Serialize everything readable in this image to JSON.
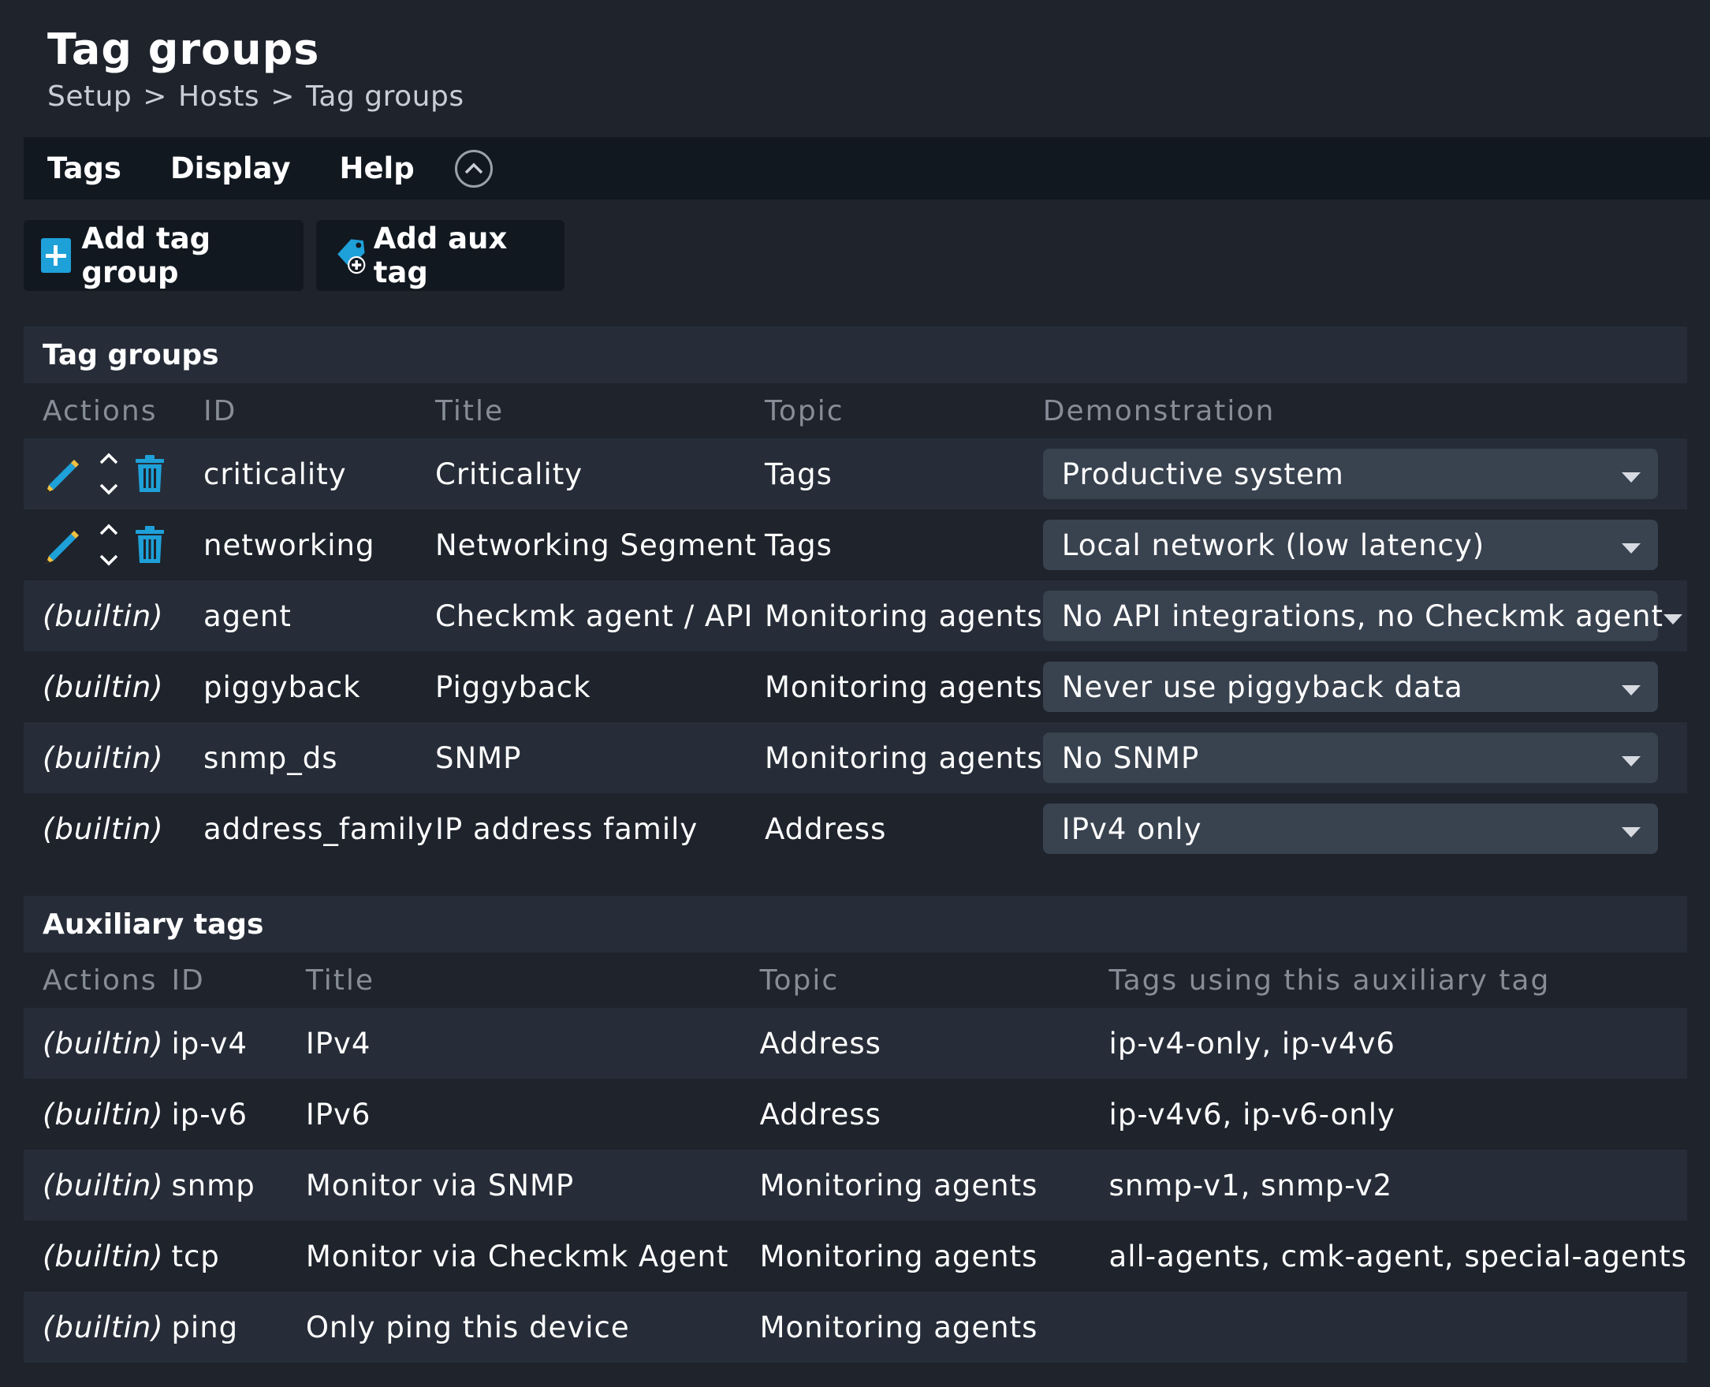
{
  "page": {
    "title": "Tag groups",
    "breadcrumb": [
      "Setup",
      "Hosts",
      "Tag groups"
    ],
    "breadcrumb_separator": ">"
  },
  "menu": {
    "items": [
      "Tags",
      "Display",
      "Help"
    ]
  },
  "buttons": {
    "add_tag_group": "Add tag group",
    "add_aux_tag": "Add aux tag"
  },
  "tag_groups": {
    "title": "Tag groups",
    "columns": [
      "Actions",
      "ID",
      "Title",
      "Topic",
      "Demonstration"
    ],
    "rows": [
      {
        "actions": "",
        "id": "criticality",
        "title": "Criticality",
        "topic": "Tags",
        "demo": "Productive system",
        "editable": true
      },
      {
        "actions": "",
        "id": "networking",
        "title": "Networking Segment",
        "topic": "Tags",
        "demo": "Local network (low latency)",
        "editable": true
      },
      {
        "actions": "(builtin)",
        "id": "agent",
        "title": "Checkmk agent / API",
        "topic": "Monitoring agents",
        "demo": "No API integrations, no Checkmk agent",
        "editable": false
      },
      {
        "actions": "(builtin)",
        "id": "piggyback",
        "title": "Piggyback",
        "topic": "Monitoring agents",
        "demo": "Never use piggyback data",
        "editable": false
      },
      {
        "actions": "(builtin)",
        "id": "snmp_ds",
        "title": "SNMP",
        "topic": "Monitoring agents",
        "demo": "No SNMP",
        "editable": false
      },
      {
        "actions": "(builtin)",
        "id": "address_family",
        "title": "IP address family",
        "topic": "Address",
        "demo": "IPv4 only",
        "editable": false
      }
    ]
  },
  "aux_tags": {
    "title": "Auxiliary tags",
    "columns": [
      "Actions",
      "ID",
      "Title",
      "Topic",
      "Tags using this auxiliary tag"
    ],
    "rows": [
      {
        "actions": "(builtin)",
        "id": "ip-v4",
        "title": "IPv4",
        "topic": "Address",
        "tags": "ip-v4-only, ip-v4v6"
      },
      {
        "actions": "(builtin)",
        "id": "ip-v6",
        "title": "IPv6",
        "topic": "Address",
        "tags": "ip-v4v6, ip-v6-only"
      },
      {
        "actions": "(builtin)",
        "id": "snmp",
        "title": "Monitor via SNMP",
        "topic": "Monitoring agents",
        "tags": "snmp-v1, snmp-v2"
      },
      {
        "actions": "(builtin)",
        "id": "tcp",
        "title": "Monitor via Checkmk Agent",
        "topic": "Monitoring agents",
        "tags": "all-agents, cmk-agent, special-agents"
      },
      {
        "actions": "(builtin)",
        "id": "ping",
        "title": "Only ping this device",
        "topic": "Monitoring agents",
        "tags": ""
      }
    ]
  },
  "colors": {
    "background": "#1e232c",
    "row_alt": "#262d38",
    "menubar": "#121820",
    "accent": "#1ea0d8",
    "select_bg": "#39424f"
  },
  "icons": {
    "edit": "pencil-icon",
    "move": "up-down-arrows-icon",
    "delete": "trash-icon",
    "add": "plus-icon",
    "add_aux": "tag-plus-icon",
    "collapse": "chevron-up-circle-icon",
    "dropdown": "caret-down-icon"
  }
}
